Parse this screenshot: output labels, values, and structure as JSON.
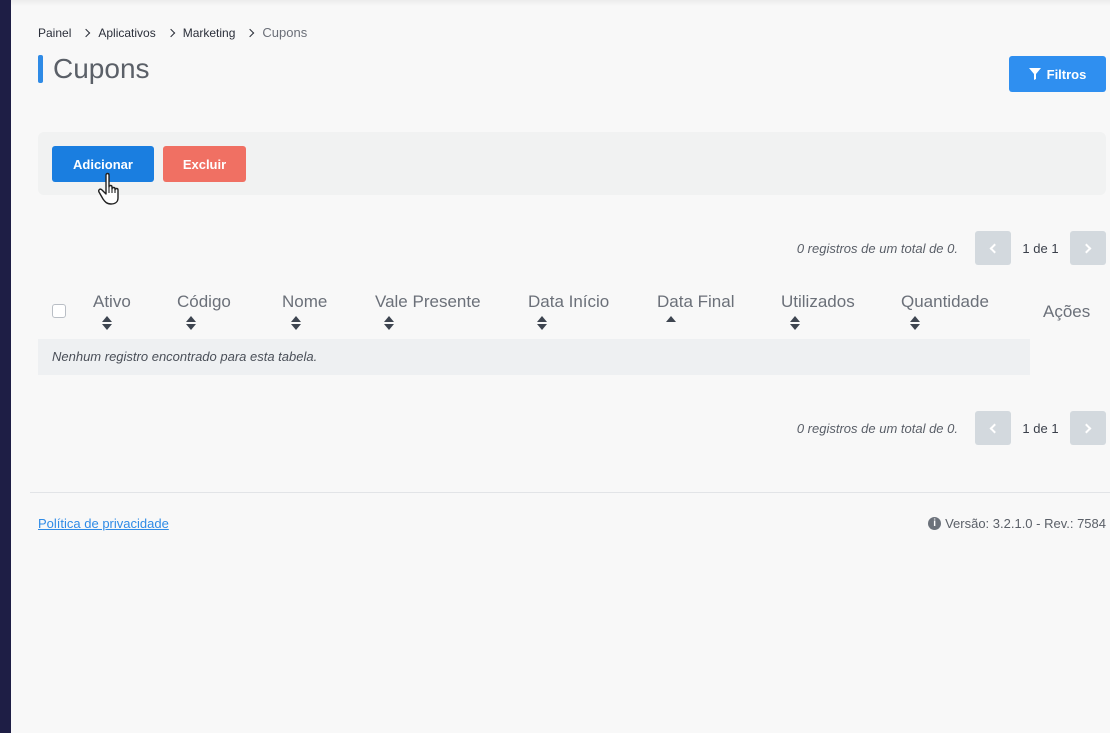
{
  "breadcrumb": [
    "Painel",
    "Aplicativos",
    "Marketing",
    "Cupons"
  ],
  "page_title": "Cupons",
  "filters_label": "Filtros",
  "actions": {
    "add_label": "Adicionar",
    "delete_label": "Excluir"
  },
  "pagination": {
    "summary": "0 registros de um total de 0.",
    "page_info": "1 de 1"
  },
  "table": {
    "columns": [
      {
        "label": "Ativo",
        "sort": "both"
      },
      {
        "label": "Código",
        "sort": "both"
      },
      {
        "label": "Nome",
        "sort": "both"
      },
      {
        "label": "Vale Presente",
        "sort": "both"
      },
      {
        "label": "Data Início",
        "sort": "both"
      },
      {
        "label": "Data Final",
        "sort": "asc"
      },
      {
        "label": "Utilizados",
        "sort": "both"
      },
      {
        "label": "Quantidade",
        "sort": "both"
      }
    ],
    "actions_header": "Ações",
    "empty_message": "Nenhum registro encontrado para esta tabela."
  },
  "footer": {
    "privacy_link": "Política de privacidade",
    "version": "Versão: 3.2.1.0 - Rev.: 7584"
  },
  "colors": {
    "primary": "#1a7ee0",
    "danger": "#f07063",
    "filters": "#2f8ff0",
    "rail": "#1e1e45"
  }
}
